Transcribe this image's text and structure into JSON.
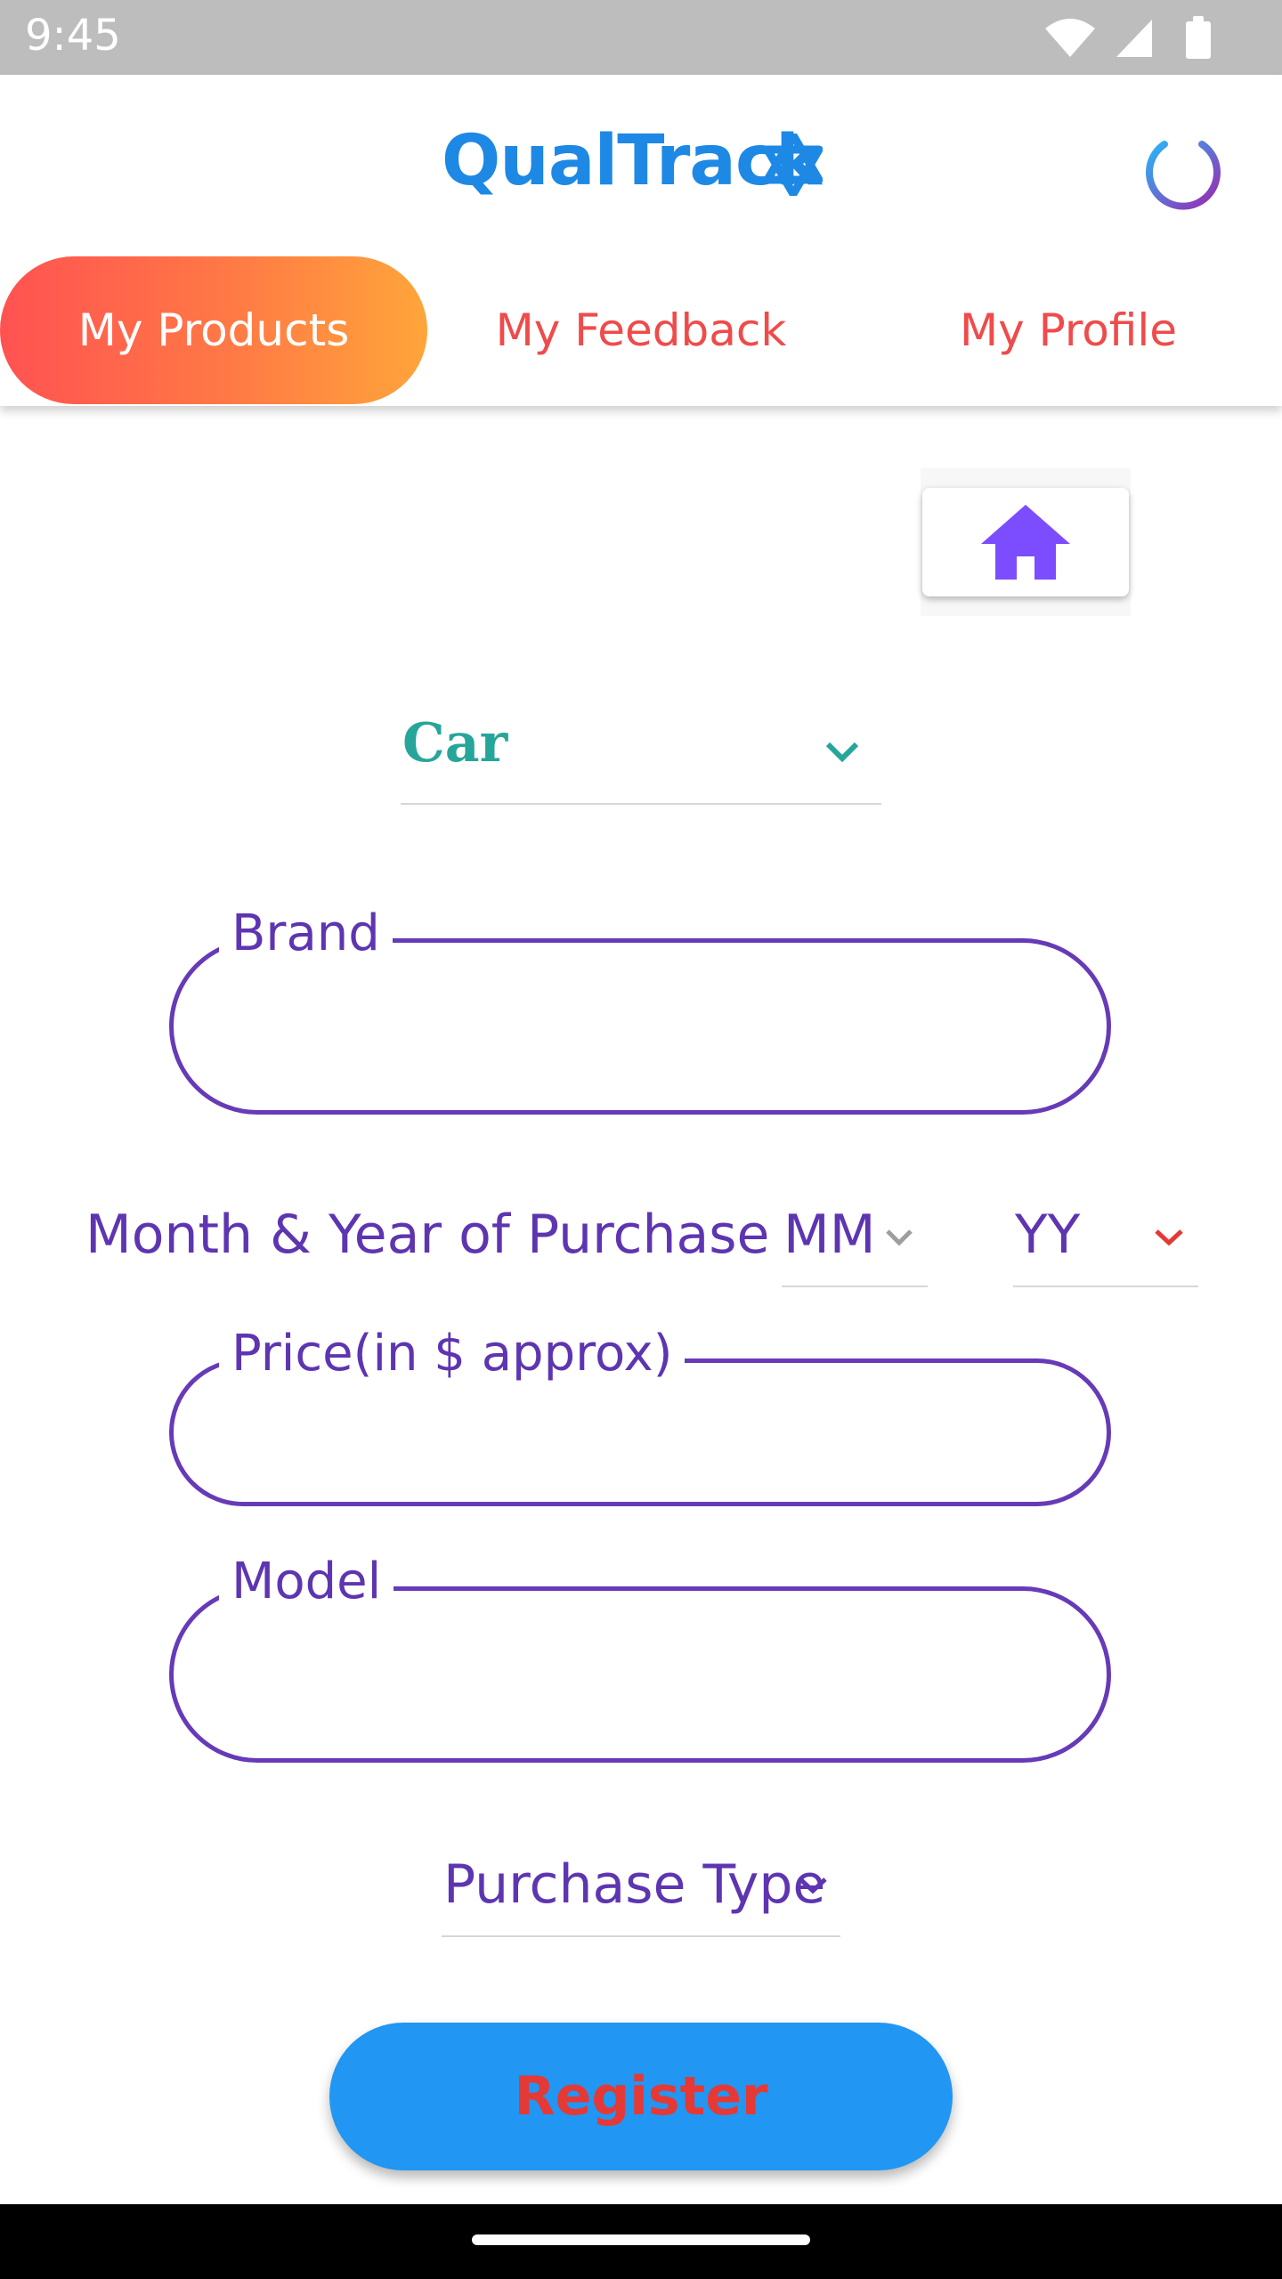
{
  "status_bar": {
    "time": "9:45"
  },
  "header": {
    "app_name": "QualTrack"
  },
  "tabs": [
    {
      "label": "My Products",
      "active": true
    },
    {
      "label": "My Feedback",
      "active": false
    },
    {
      "label": "My Profile",
      "active": false
    }
  ],
  "form": {
    "category": {
      "selected": "Car"
    },
    "brand": {
      "label": "Brand",
      "value": ""
    },
    "purchase_date": {
      "label": "Month & Year of Purchase",
      "month_placeholder": "MM",
      "year_placeholder": "YY"
    },
    "price": {
      "label": "Price(in $ approx)",
      "value": ""
    },
    "model": {
      "label": "Model",
      "value": ""
    },
    "purchase_type": {
      "placeholder": "Purchase Type"
    },
    "register_label": "Register"
  },
  "colors": {
    "brand_blue": "#1e88e5",
    "tab_gradient_start": "#ff5252",
    "tab_gradient_end": "#ffa53a",
    "tab_inactive_text": "#ef4b4b",
    "field_purple": "#673ab7",
    "category_teal": "#26a69a",
    "home_icon_purple": "#7c4dff",
    "register_bg": "#2196f3",
    "register_text": "#e53935"
  },
  "icons": {
    "status": [
      "wifi-icon",
      "signal-icon",
      "battery-icon"
    ],
    "logo": "star-of-david-icon",
    "power": "power-icon",
    "home": "home-icon",
    "chevron": "chevron-down-icon"
  }
}
